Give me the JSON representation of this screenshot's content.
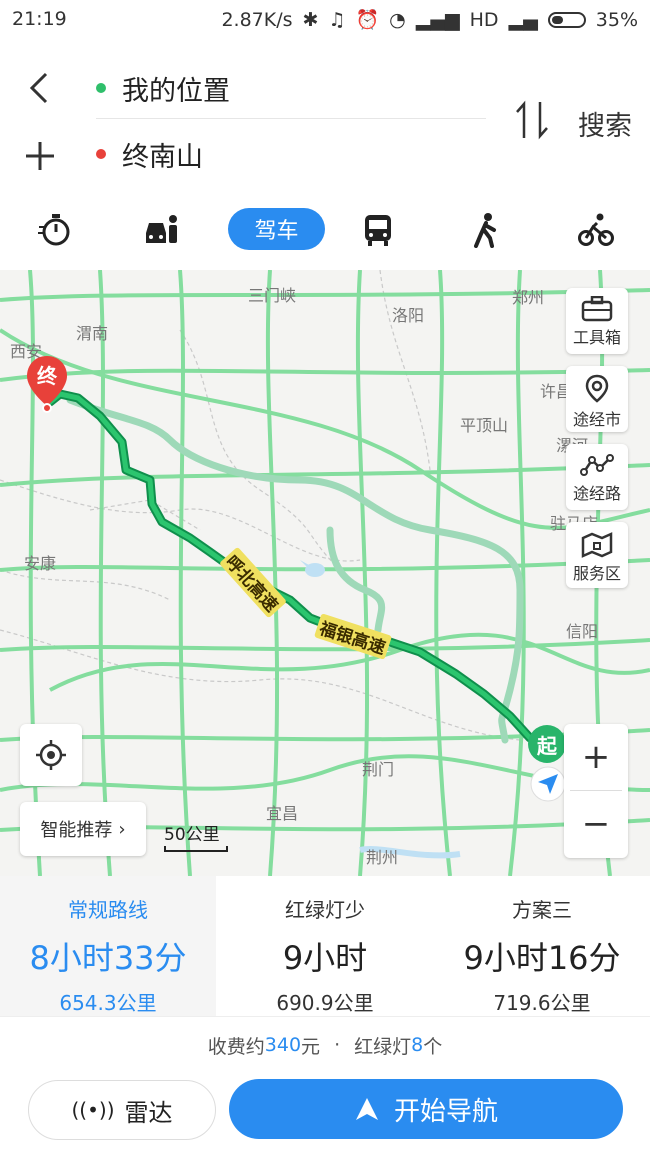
{
  "status_bar": {
    "time": "21:19",
    "net_speed": "2.87K/s",
    "network": "HD",
    "battery": "35%",
    "battery_level": 0.35
  },
  "search": {
    "origin": "我的位置",
    "destination": "终南山",
    "search_label": "搜索"
  },
  "modes": {
    "active_label": "驾车"
  },
  "map": {
    "cities": [
      "西安",
      "渭南",
      "三门峡",
      "洛阳",
      "郑州",
      "许昌",
      "平顶山",
      "漯河",
      "驻马店",
      "安康",
      "信阳",
      "荆门",
      "宜昌",
      "荆州"
    ],
    "road_labels": [
      "呼北高速",
      "福银高速"
    ],
    "end_marker": "终",
    "start_marker": "起",
    "tools": [
      "工具箱",
      "途经市",
      "途经路",
      "服务区"
    ],
    "recommend": "智能推荐",
    "scale": "50公里",
    "zoom_in": "+",
    "zoom_out": "−"
  },
  "routes": [
    {
      "name": "常规路线",
      "duration": "8小时33分",
      "distance": "654.3公里"
    },
    {
      "name": "红绿灯少",
      "duration": "9小时",
      "distance": "690.9公里"
    },
    {
      "name": "方案三",
      "duration": "9小时16分",
      "distance": "719.6公里"
    }
  ],
  "fee": {
    "toll_prefix": "收费约",
    "toll_value": "340",
    "toll_unit": "元",
    "dot": "·",
    "light_prefix": "红绿灯",
    "light_value": "8",
    "light_unit": "个"
  },
  "actions": {
    "radar": "雷达",
    "start_nav": "开始导航"
  },
  "colors": {
    "accent": "#2a8cf0",
    "route_main": "#1aa35a",
    "route_alt": "#9ed9b8",
    "road": "#7fdc9a",
    "end_pin": "#e8413a",
    "start_pin": "#28b46a"
  }
}
